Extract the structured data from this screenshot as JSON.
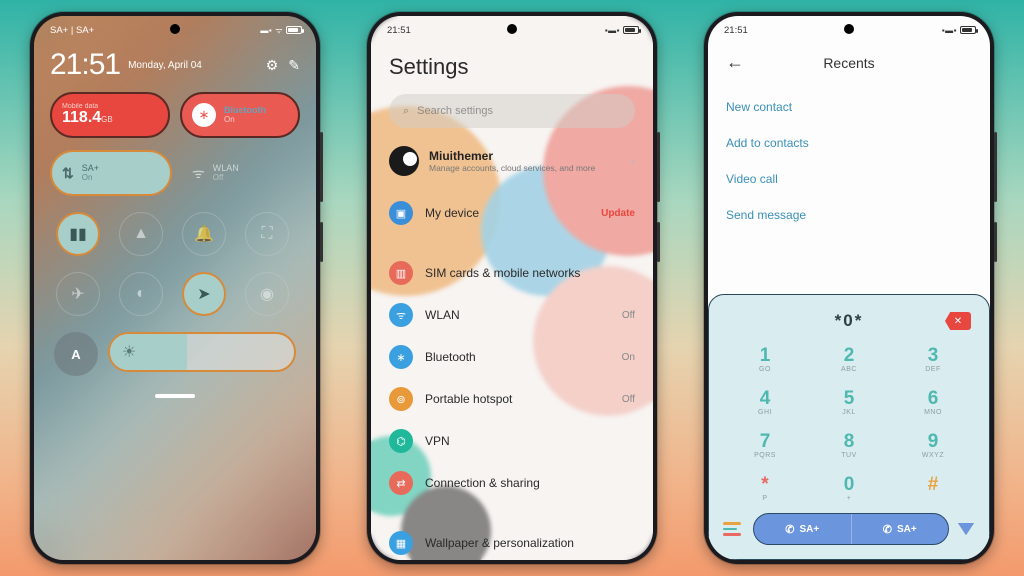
{
  "status": {
    "time": "21:51",
    "carrier": "SA+ | SA+"
  },
  "p1": {
    "clock": "21:51",
    "date": "Monday, April 04",
    "data_label": "Mobile data",
    "data_value": "118.4",
    "data_unit": "GB",
    "bt_label": "Bluetooth",
    "bt_state": "On",
    "sim_label": "SA+",
    "sim_state": "On",
    "wlan_label": "WLAN",
    "wlan_state": "Off",
    "auto": "A"
  },
  "p2": {
    "title": "Settings",
    "search_ph": "Search settings",
    "acct_name": "Miuithemer",
    "acct_desc": "Manage accounts, cloud services, and more",
    "rows": [
      {
        "label": "My device",
        "val": "Update",
        "upd": true,
        "color": "#3a8fd8",
        "glyph": "▣"
      },
      {
        "label": "SIM cards & mobile networks",
        "val": "",
        "color": "#e86a5a",
        "glyph": "▥"
      },
      {
        "label": "WLAN",
        "val": "Off",
        "color": "#3aa0e0",
        "glyph": "ᯤ"
      },
      {
        "label": "Bluetooth",
        "val": "On",
        "color": "#3aa0e0",
        "glyph": "∗"
      },
      {
        "label": "Portable hotspot",
        "val": "Off",
        "color": "#e89a3a",
        "glyph": "⊚"
      },
      {
        "label": "VPN",
        "val": "",
        "color": "#1fb89a",
        "glyph": "⌬"
      },
      {
        "label": "Connection & sharing",
        "val": "",
        "color": "#e86a5a",
        "glyph": "⇄"
      },
      {
        "label": "Wallpaper & personalization",
        "val": "",
        "color": "#3aa0e0",
        "glyph": "▦"
      }
    ]
  },
  "p3": {
    "title": "Recents",
    "menu": [
      "New contact",
      "Add to contacts",
      "Video call",
      "Send message"
    ],
    "dialed": "*0*",
    "keys": [
      {
        "n": "1",
        "l": "GO"
      },
      {
        "n": "2",
        "l": "ABC"
      },
      {
        "n": "3",
        "l": "DEF"
      },
      {
        "n": "4",
        "l": "GHI"
      },
      {
        "n": "5",
        "l": "JKL"
      },
      {
        "n": "6",
        "l": "MNO"
      },
      {
        "n": "7",
        "l": "PQRS"
      },
      {
        "n": "8",
        "l": "TUV"
      },
      {
        "n": "9",
        "l": "WXYZ"
      },
      {
        "n": "*",
        "l": "P"
      },
      {
        "n": "0",
        "l": "+"
      },
      {
        "n": "#",
        "l": ""
      }
    ],
    "call1": "SA+",
    "call2": "SA+"
  }
}
